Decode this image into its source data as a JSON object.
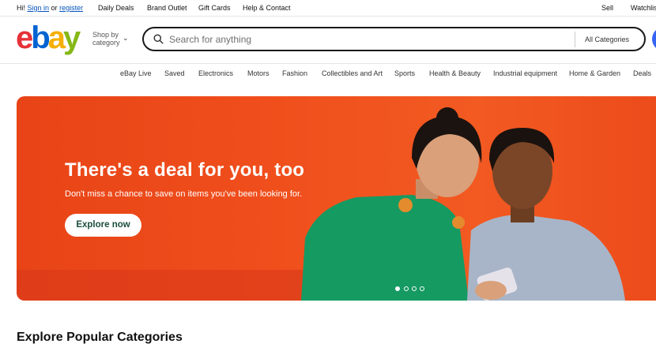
{
  "topbar": {
    "greeting": "Hi!",
    "sign_in": "Sign in",
    "or": "or",
    "register": "register",
    "links": [
      "Daily Deals",
      "Brand Outlet",
      "Gift Cards",
      "Help & Contact"
    ],
    "sell": "Sell",
    "watchlist": "Watchlis"
  },
  "header": {
    "logo": {
      "e": "e",
      "b": "b",
      "a": "a",
      "y": "y"
    },
    "shop_by_line1": "Shop by",
    "shop_by_line2": "category",
    "shop_by_chevron": "⌄",
    "search_placeholder": "Search for anything",
    "search_icon": "search-icon",
    "category_select": "All Categories"
  },
  "nav": {
    "items": [
      "eBay Live",
      "Saved",
      "Electronics",
      "Motors",
      "Fashion",
      "Collectibles and Art",
      "Sports",
      "Health & Beauty",
      "Industrial equipment",
      "Home & Garden",
      "Deals"
    ]
  },
  "hero": {
    "title": "There's a deal for you, too",
    "subtitle": "Don't miss a chance to save on items you've been looking for.",
    "button": "Explore now",
    "active_slide": 1,
    "slide_count": 4
  },
  "section": {
    "title": "Explore Popular Categories"
  },
  "colors": {
    "brand_blue": "#3665f3",
    "hero_orange": "#f04f1c",
    "link_blue": "#0654ba",
    "button_text": "#1b4d3e"
  }
}
